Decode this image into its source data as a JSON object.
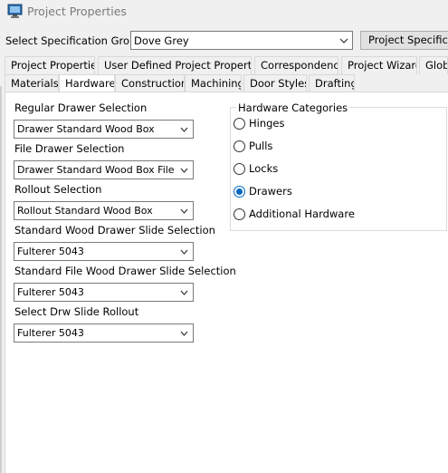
{
  "window": {
    "title": "Project Properties",
    "icon": "monitor-icon"
  },
  "spec_group": {
    "label": "Select Specification Group",
    "value": "Dove Grey",
    "button_label": "Project Specifications"
  },
  "tabs_row1": [
    {
      "label": "Project Properties"
    },
    {
      "label": "User Defined Project Properties"
    },
    {
      "label": "Correspondence"
    },
    {
      "label": "Project Wizard"
    },
    {
      "label": "Global"
    }
  ],
  "tabs_row2": [
    {
      "label": "Materials"
    },
    {
      "label": "Hardware"
    },
    {
      "label": "Construction"
    },
    {
      "label": "Machining"
    },
    {
      "label": "Door Styles"
    },
    {
      "label": "Drafting"
    }
  ],
  "selected_tab": "Hardware",
  "selections": [
    {
      "label": "Regular Drawer Selection",
      "value": "Drawer Standard Wood Box"
    },
    {
      "label": "File Drawer Selection",
      "value": "Drawer Standard Wood Box File"
    },
    {
      "label": "Rollout Selection",
      "value": "Rollout Standard Wood Box"
    },
    {
      "label": "Standard Wood Drawer Slide Selection",
      "value": "Fulterer 5043"
    },
    {
      "label": "Standard File Wood Drawer Slide Selection",
      "value": "Fulterer 5043"
    },
    {
      "label": "Select Drw Slide Rollout",
      "value": "Fulterer 5043"
    }
  ],
  "hardware_categories": {
    "title": "Hardware Categories",
    "options": [
      {
        "label": "Hinges",
        "checked": false
      },
      {
        "label": "Pulls",
        "checked": false
      },
      {
        "label": "Locks",
        "checked": false
      },
      {
        "label": "Drawers",
        "checked": true
      },
      {
        "label": "Additional Hardware",
        "checked": false
      }
    ]
  },
  "colors": {
    "accent": "#0067c0",
    "background": "#f0f0f0",
    "panel": "#ffffff"
  }
}
